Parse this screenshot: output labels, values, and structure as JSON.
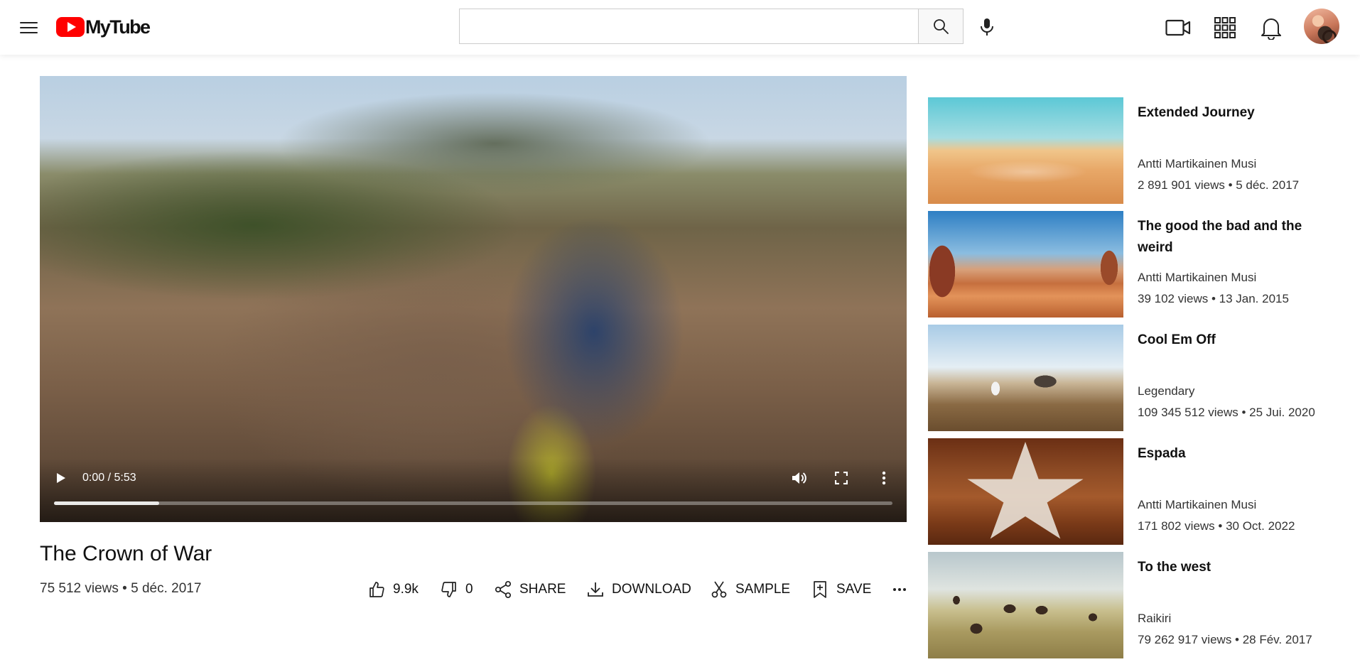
{
  "app": {
    "brand": "MyTube",
    "brand_color": "#ff0000"
  },
  "search": {
    "value": "",
    "placeholder": ""
  },
  "header_icons": [
    "menu-icon",
    "search-icon",
    "mic-icon",
    "video-camera-icon",
    "apps-grid-icon",
    "bell-icon"
  ],
  "player": {
    "current_time": "0:00",
    "duration": "5:53",
    "time_text": "0:00 / 5:53",
    "buffered_fraction": 0.125
  },
  "video": {
    "title": "The Crown of War",
    "meta": "75 512 views • 5 déc. 2017",
    "likes": "9.9k",
    "dislikes": "0",
    "share_label": "SHARE",
    "download_label": "DOWNLOAD",
    "sample_label": "SAMPLE",
    "save_label": "SAVE"
  },
  "recommendations": [
    {
      "title": "Extended Journey",
      "channel": "Antti Martikainen Musi",
      "stats": "2 891 901 views • 5 déc. 2017"
    },
    {
      "title": "The good the bad and the weird",
      "channel": "Antti Martikainen Musi",
      "stats": "39 102 views • 13 Jan. 2015"
    },
    {
      "title": "Cool Em Off",
      "channel": "Legendary",
      "stats": "109 345 512 views • 25 Jui. 2020"
    },
    {
      "title": "Espada",
      "channel": "Antti Martikainen Musi",
      "stats": "171 802 views • 30 Oct. 2022"
    },
    {
      "title": "To the west",
      "channel": "Raikiri",
      "stats": "79 262 917 views • 28 Fév. 2017"
    }
  ]
}
